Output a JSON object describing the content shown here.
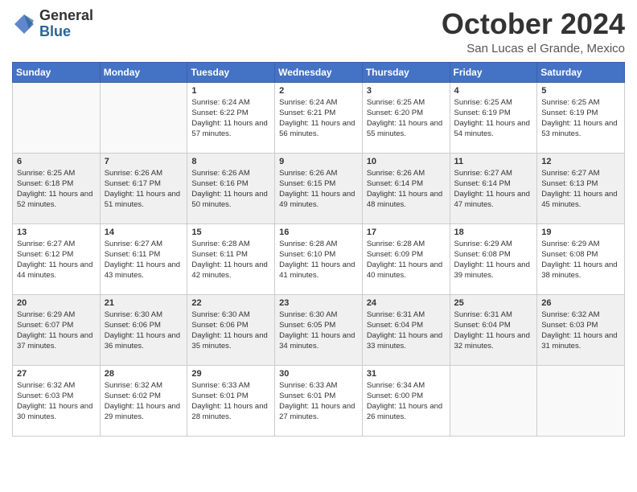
{
  "header": {
    "logo_general": "General",
    "logo_blue": "Blue",
    "month_title": "October 2024",
    "location": "San Lucas el Grande, Mexico"
  },
  "weekdays": [
    "Sunday",
    "Monday",
    "Tuesday",
    "Wednesday",
    "Thursday",
    "Friday",
    "Saturday"
  ],
  "weeks": [
    [
      {
        "day": "",
        "sunrise": "",
        "sunset": "",
        "daylight": ""
      },
      {
        "day": "",
        "sunrise": "",
        "sunset": "",
        "daylight": ""
      },
      {
        "day": "1",
        "sunrise": "Sunrise: 6:24 AM",
        "sunset": "Sunset: 6:22 PM",
        "daylight": "Daylight: 11 hours and 57 minutes."
      },
      {
        "day": "2",
        "sunrise": "Sunrise: 6:24 AM",
        "sunset": "Sunset: 6:21 PM",
        "daylight": "Daylight: 11 hours and 56 minutes."
      },
      {
        "day": "3",
        "sunrise": "Sunrise: 6:25 AM",
        "sunset": "Sunset: 6:20 PM",
        "daylight": "Daylight: 11 hours and 55 minutes."
      },
      {
        "day": "4",
        "sunrise": "Sunrise: 6:25 AM",
        "sunset": "Sunset: 6:19 PM",
        "daylight": "Daylight: 11 hours and 54 minutes."
      },
      {
        "day": "5",
        "sunrise": "Sunrise: 6:25 AM",
        "sunset": "Sunset: 6:19 PM",
        "daylight": "Daylight: 11 hours and 53 minutes."
      }
    ],
    [
      {
        "day": "6",
        "sunrise": "Sunrise: 6:25 AM",
        "sunset": "Sunset: 6:18 PM",
        "daylight": "Daylight: 11 hours and 52 minutes."
      },
      {
        "day": "7",
        "sunrise": "Sunrise: 6:26 AM",
        "sunset": "Sunset: 6:17 PM",
        "daylight": "Daylight: 11 hours and 51 minutes."
      },
      {
        "day": "8",
        "sunrise": "Sunrise: 6:26 AM",
        "sunset": "Sunset: 6:16 PM",
        "daylight": "Daylight: 11 hours and 50 minutes."
      },
      {
        "day": "9",
        "sunrise": "Sunrise: 6:26 AM",
        "sunset": "Sunset: 6:15 PM",
        "daylight": "Daylight: 11 hours and 49 minutes."
      },
      {
        "day": "10",
        "sunrise": "Sunrise: 6:26 AM",
        "sunset": "Sunset: 6:14 PM",
        "daylight": "Daylight: 11 hours and 48 minutes."
      },
      {
        "day": "11",
        "sunrise": "Sunrise: 6:27 AM",
        "sunset": "Sunset: 6:14 PM",
        "daylight": "Daylight: 11 hours and 47 minutes."
      },
      {
        "day": "12",
        "sunrise": "Sunrise: 6:27 AM",
        "sunset": "Sunset: 6:13 PM",
        "daylight": "Daylight: 11 hours and 45 minutes."
      }
    ],
    [
      {
        "day": "13",
        "sunrise": "Sunrise: 6:27 AM",
        "sunset": "Sunset: 6:12 PM",
        "daylight": "Daylight: 11 hours and 44 minutes."
      },
      {
        "day": "14",
        "sunrise": "Sunrise: 6:27 AM",
        "sunset": "Sunset: 6:11 PM",
        "daylight": "Daylight: 11 hours and 43 minutes."
      },
      {
        "day": "15",
        "sunrise": "Sunrise: 6:28 AM",
        "sunset": "Sunset: 6:11 PM",
        "daylight": "Daylight: 11 hours and 42 minutes."
      },
      {
        "day": "16",
        "sunrise": "Sunrise: 6:28 AM",
        "sunset": "Sunset: 6:10 PM",
        "daylight": "Daylight: 11 hours and 41 minutes."
      },
      {
        "day": "17",
        "sunrise": "Sunrise: 6:28 AM",
        "sunset": "Sunset: 6:09 PM",
        "daylight": "Daylight: 11 hours and 40 minutes."
      },
      {
        "day": "18",
        "sunrise": "Sunrise: 6:29 AM",
        "sunset": "Sunset: 6:08 PM",
        "daylight": "Daylight: 11 hours and 39 minutes."
      },
      {
        "day": "19",
        "sunrise": "Sunrise: 6:29 AM",
        "sunset": "Sunset: 6:08 PM",
        "daylight": "Daylight: 11 hours and 38 minutes."
      }
    ],
    [
      {
        "day": "20",
        "sunrise": "Sunrise: 6:29 AM",
        "sunset": "Sunset: 6:07 PM",
        "daylight": "Daylight: 11 hours and 37 minutes."
      },
      {
        "day": "21",
        "sunrise": "Sunrise: 6:30 AM",
        "sunset": "Sunset: 6:06 PM",
        "daylight": "Daylight: 11 hours and 36 minutes."
      },
      {
        "day": "22",
        "sunrise": "Sunrise: 6:30 AM",
        "sunset": "Sunset: 6:06 PM",
        "daylight": "Daylight: 11 hours and 35 minutes."
      },
      {
        "day": "23",
        "sunrise": "Sunrise: 6:30 AM",
        "sunset": "Sunset: 6:05 PM",
        "daylight": "Daylight: 11 hours and 34 minutes."
      },
      {
        "day": "24",
        "sunrise": "Sunrise: 6:31 AM",
        "sunset": "Sunset: 6:04 PM",
        "daylight": "Daylight: 11 hours and 33 minutes."
      },
      {
        "day": "25",
        "sunrise": "Sunrise: 6:31 AM",
        "sunset": "Sunset: 6:04 PM",
        "daylight": "Daylight: 11 hours and 32 minutes."
      },
      {
        "day": "26",
        "sunrise": "Sunrise: 6:32 AM",
        "sunset": "Sunset: 6:03 PM",
        "daylight": "Daylight: 11 hours and 31 minutes."
      }
    ],
    [
      {
        "day": "27",
        "sunrise": "Sunrise: 6:32 AM",
        "sunset": "Sunset: 6:03 PM",
        "daylight": "Daylight: 11 hours and 30 minutes."
      },
      {
        "day": "28",
        "sunrise": "Sunrise: 6:32 AM",
        "sunset": "Sunset: 6:02 PM",
        "daylight": "Daylight: 11 hours and 29 minutes."
      },
      {
        "day": "29",
        "sunrise": "Sunrise: 6:33 AM",
        "sunset": "Sunset: 6:01 PM",
        "daylight": "Daylight: 11 hours and 28 minutes."
      },
      {
        "day": "30",
        "sunrise": "Sunrise: 6:33 AM",
        "sunset": "Sunset: 6:01 PM",
        "daylight": "Daylight: 11 hours and 27 minutes."
      },
      {
        "day": "31",
        "sunrise": "Sunrise: 6:34 AM",
        "sunset": "Sunset: 6:00 PM",
        "daylight": "Daylight: 11 hours and 26 minutes."
      },
      {
        "day": "",
        "sunrise": "",
        "sunset": "",
        "daylight": ""
      },
      {
        "day": "",
        "sunrise": "",
        "sunset": "",
        "daylight": ""
      }
    ]
  ]
}
